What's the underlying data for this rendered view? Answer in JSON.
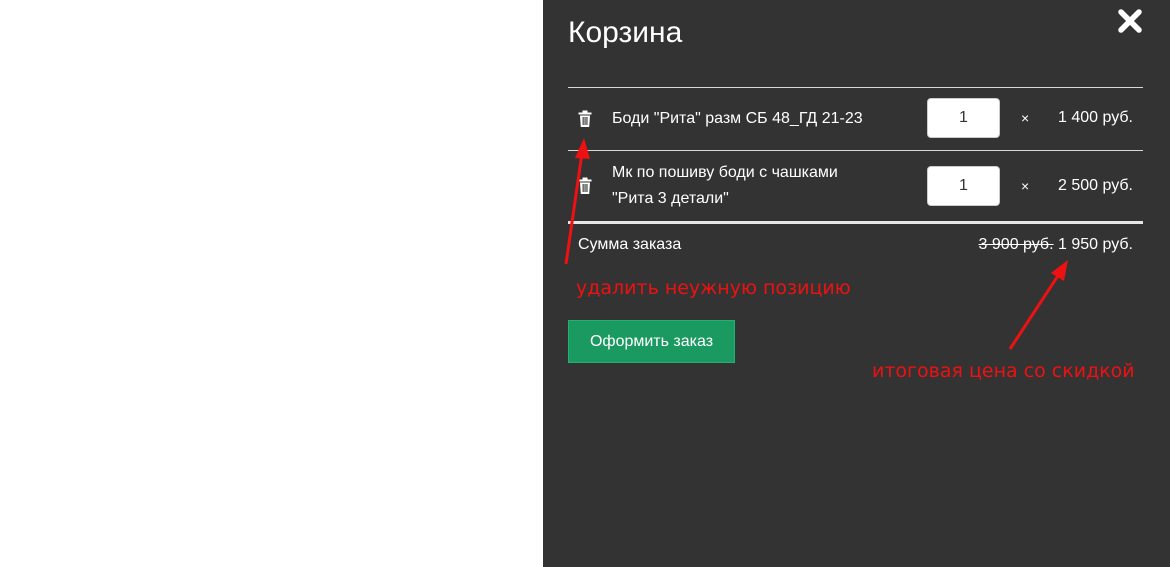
{
  "cart": {
    "title": "Корзина",
    "items": [
      {
        "name": "Боди \"Рита\" разм СБ 48_ГД 21-23",
        "quantity": "1",
        "times": "×",
        "price": "1 400 руб."
      },
      {
        "name": "Мк по пошиву боди с чашками \"Рита 3 детали\"",
        "quantity": "1",
        "times": "×",
        "price": "2 500 руб."
      }
    ],
    "total_label": "Сумма заказа",
    "old_total": "3 900 руб.",
    "new_total": "1 950 руб.",
    "checkout_label": "Оформить заказ"
  },
  "annotations": {
    "delete_hint": "удалить неужную позицию",
    "price_hint": "итоговая цена со скидкой"
  },
  "colors": {
    "panel_bg": "#333333",
    "button_green": "#1a9960",
    "annotation_red": "#ee1111"
  },
  "icons": {
    "close": "close-icon",
    "delete": "trash-icon"
  }
}
